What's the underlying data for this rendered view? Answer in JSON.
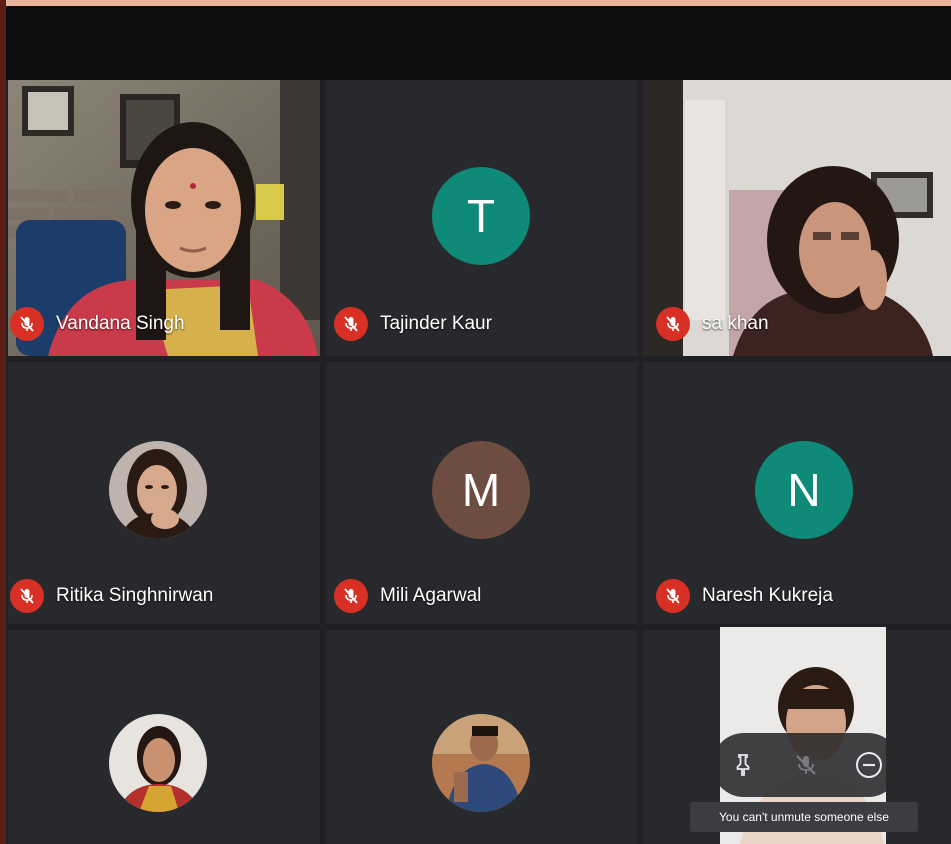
{
  "colors": {
    "background": "#202124",
    "mic_off": "#d93025",
    "teal_avatar": "#0f8a78",
    "brown_avatar": "#6d4c41",
    "header": "#0e0e0f"
  },
  "participants": [
    {
      "name": "Vandana Singh",
      "type": "video",
      "muted": true
    },
    {
      "name": "Tajinder Kaur",
      "type": "initial",
      "initial": "T",
      "muted": true
    },
    {
      "name": "sa  khan",
      "type": "video",
      "muted": true
    },
    {
      "name": "Ritika Singhnirwan",
      "type": "photo",
      "muted": true
    },
    {
      "name": "Mili Agarwal",
      "type": "initial",
      "initial": "M",
      "muted": true
    },
    {
      "name": "Naresh Kukreja",
      "type": "initial",
      "initial": "N",
      "muted": true
    },
    {
      "name": "",
      "type": "photo"
    },
    {
      "name": "",
      "type": "photo"
    },
    {
      "name": "",
      "type": "video"
    }
  ],
  "controls": {
    "pin_icon": "pin-icon",
    "mute_icon": "mic-off-icon",
    "remove_icon": "remove-icon",
    "tooltip": "You can't unmute someone else"
  }
}
